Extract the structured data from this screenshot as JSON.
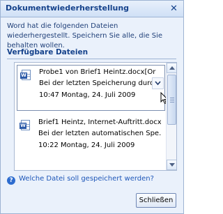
{
  "pane": {
    "title": "Dokumentwiederherstellung",
    "close_glyph": "✕",
    "intro": "Word hat die folgenden Dateien wiederhergestellt. Speichern Sie alle, die Sie behalten wollen.",
    "section_heading": "Verfügbare Dateien"
  },
  "files": [
    {
      "name": "Probe1 von Brief1 Heintz.docx[Or",
      "status": "Bei der letzten Speicherung durch",
      "time": "10:47 Montag, 24. Juli 2009",
      "icon": "word-document-icon"
    },
    {
      "name": "Brief1 Heintz, Internet-Auftritt.docx",
      "status": "Bei der letzten automatischen Spe...",
      "time": "10:22 Montag, 24. Juli 2009",
      "icon": "word-document-icon"
    }
  ],
  "help_link": "Welche Datei soll gespeichert werden?",
  "close_button": "Schließen",
  "colors": {
    "pane_background": "#eaf1fb",
    "heading_text": "#15428b",
    "link_text": "#1d56b8"
  }
}
